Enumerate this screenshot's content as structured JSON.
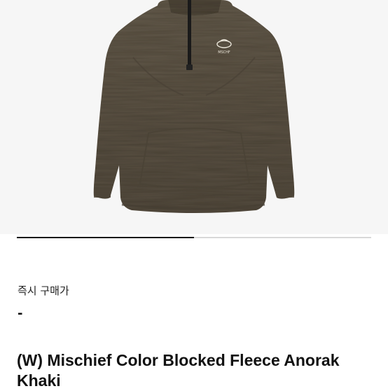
{
  "product": {
    "image": {
      "alt": "(W) Mischief Color Blocked Fleece Anorak Khaki",
      "logo_text": "MSCHF",
      "main_color": "#5a5143",
      "background_color": "#f6f6f6",
      "zip_color": "#1a1a1a"
    },
    "gallery": {
      "progress_fraction": 0.5
    },
    "instant_purchase_label": "즉시 구매가",
    "price": "-",
    "title": "(W) Mischief Color Blocked Fleece Anorak Khaki"
  }
}
